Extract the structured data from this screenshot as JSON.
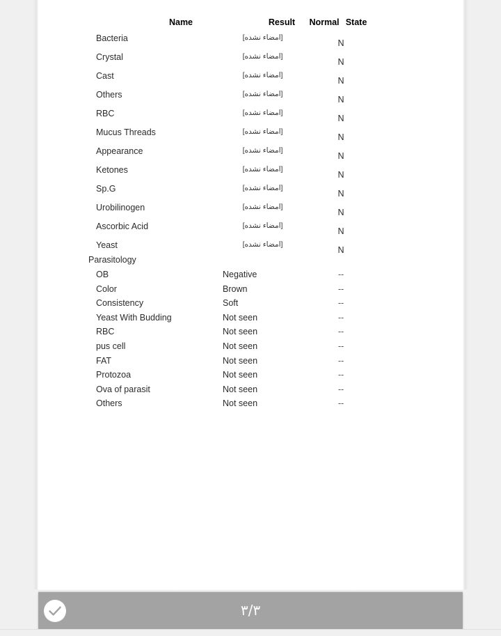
{
  "document": {
    "table": {
      "headers": {
        "name": "Name",
        "result": "Result",
        "normal": "Normal",
        "state": "State"
      },
      "sections": [
        {
          "title": "",
          "rows": [
            {
              "name": "Bacteria",
              "result": "[امضاء نشده]",
              "normal": "",
              "state": "N"
            },
            {
              "name": "Crystal",
              "result": "[امضاء نشده]",
              "normal": "",
              "state": "N"
            },
            {
              "name": "Cast",
              "result": "[امضاء نشده]",
              "normal": "",
              "state": "N"
            },
            {
              "name": "Others",
              "result": "[امضاء نشده]",
              "normal": "",
              "state": "N"
            },
            {
              "name": "RBC",
              "result": "[امضاء نشده]",
              "normal": "",
              "state": "N"
            },
            {
              "name": "Mucus Threads",
              "result": "[امضاء نشده]",
              "normal": "",
              "state": "N"
            },
            {
              "name": "Appearance",
              "result": "[امضاء نشده]",
              "normal": "",
              "state": "N"
            },
            {
              "name": "Ketones",
              "result": "[امضاء نشده]",
              "normal": "",
              "state": "N"
            },
            {
              "name": "Sp.G",
              "result": "[امضاء نشده]",
              "normal": "",
              "state": "N"
            },
            {
              "name": "Urobilinogen",
              "result": "[امضاء نشده]",
              "normal": "",
              "state": "N"
            },
            {
              "name": "Ascorbic Acid",
              "result": "[امضاء نشده]",
              "normal": "",
              "state": "N"
            },
            {
              "name": "Yeast",
              "result": "[امضاء نشده]",
              "normal": "",
              "state": "N"
            }
          ]
        },
        {
          "title": "Parasitology",
          "rows": [
            {
              "name": "OB",
              "result": "Negative",
              "normal": "--",
              "state": ""
            },
            {
              "name": "Color",
              "result": "Brown",
              "normal": "--",
              "state": ""
            },
            {
              "name": "Consistency",
              "result": "Soft",
              "normal": "--",
              "state": ""
            },
            {
              "name": "Yeast With Budding",
              "result": "Not seen",
              "normal": "--",
              "state": ""
            },
            {
              "name": "RBC",
              "result": "Not seen",
              "normal": "--",
              "state": ""
            },
            {
              "name": "pus cell",
              "result": "Not seen",
              "normal": "--",
              "state": ""
            },
            {
              "name": "FAT",
              "result": "Not seen",
              "normal": "--",
              "state": ""
            },
            {
              "name": "Protozoa",
              "result": "Not seen",
              "normal": "--",
              "state": ""
            },
            {
              "name": "Ova of parasit",
              "result": "Not seen",
              "normal": "--",
              "state": ""
            },
            {
              "name": "Others",
              "result": "Not seen",
              "normal": "--",
              "state": ""
            }
          ]
        }
      ]
    }
  },
  "toolbar": {
    "page_indicator": "۳/۳",
    "confirm_icon": "check-circle-icon"
  },
  "colors": {
    "page_background": "#ffffff",
    "viewer_background": "#f0f0f0",
    "toolbar_background": "#a3a3a3",
    "toolbar_text": "#ffffff",
    "body_text": "#2b2b2b"
  }
}
